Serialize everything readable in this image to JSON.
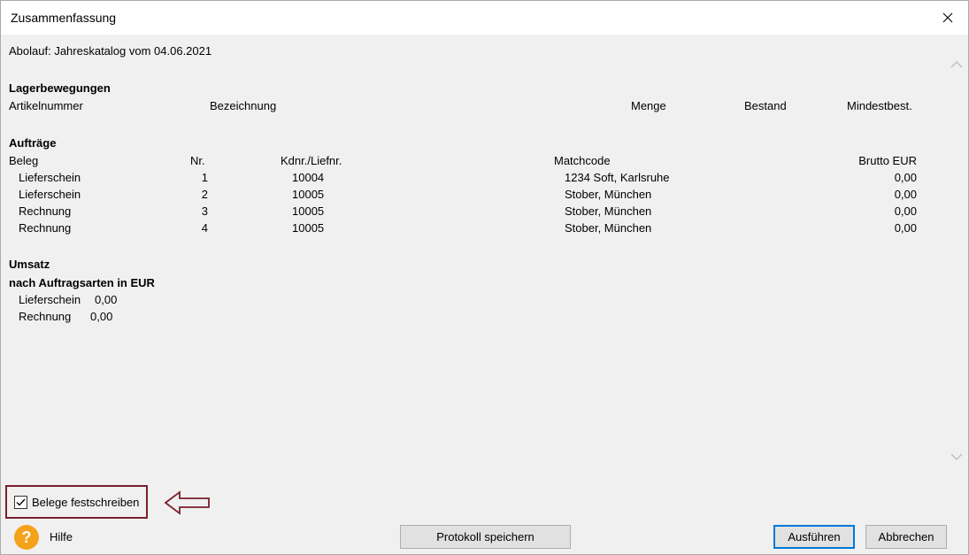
{
  "window": {
    "title": "Zusammenfassung"
  },
  "summary": {
    "ablauf": "Abolauf: Jahreskatalog vom 04.06.2021",
    "lager": {
      "heading": "Lagerbewegungen",
      "columns": [
        "Artikelnummer",
        "Bezeichnung",
        "Menge",
        "Bestand",
        "Mindestbest."
      ]
    },
    "auftraege": {
      "heading": "Aufträge",
      "columns": [
        "Beleg",
        "Nr.",
        "Kdnr./Liefnr.",
        "Matchcode",
        "Brutto EUR"
      ],
      "rows": [
        {
          "beleg": "Lieferschein",
          "nr": "1",
          "kdnr": "10004",
          "matchcode": "1234 Soft, Karlsruhe",
          "brutto": "0,00"
        },
        {
          "beleg": "Lieferschein",
          "nr": "2",
          "kdnr": "10005",
          "matchcode": "Stober, München",
          "brutto": "0,00"
        },
        {
          "beleg": "Rechnung",
          "nr": "3",
          "kdnr": "10005",
          "matchcode": "Stober, München",
          "brutto": "0,00"
        },
        {
          "beleg": "Rechnung",
          "nr": "4",
          "kdnr": "10005",
          "matchcode": "Stober, München",
          "brutto": "0,00"
        }
      ]
    },
    "umsatz": {
      "heading": "Umsatz",
      "subheading": "nach Auftragsarten in EUR",
      "rows": [
        {
          "label": "Lieferschein",
          "value": "0,00"
        },
        {
          "label": "Rechnung",
          "value": "0,00"
        }
      ]
    }
  },
  "footer": {
    "checkbox_label": "Belege festschreiben",
    "checkbox_checked": true,
    "help_label": "Hilfe",
    "save_label": "Protokoll speichern",
    "run_label": "Ausführen",
    "cancel_label": "Abbrechen"
  },
  "colors": {
    "highlight_border": "#7a1f2b",
    "help_icon": "#f5a21b",
    "primary_button_border": "#0078d7"
  }
}
